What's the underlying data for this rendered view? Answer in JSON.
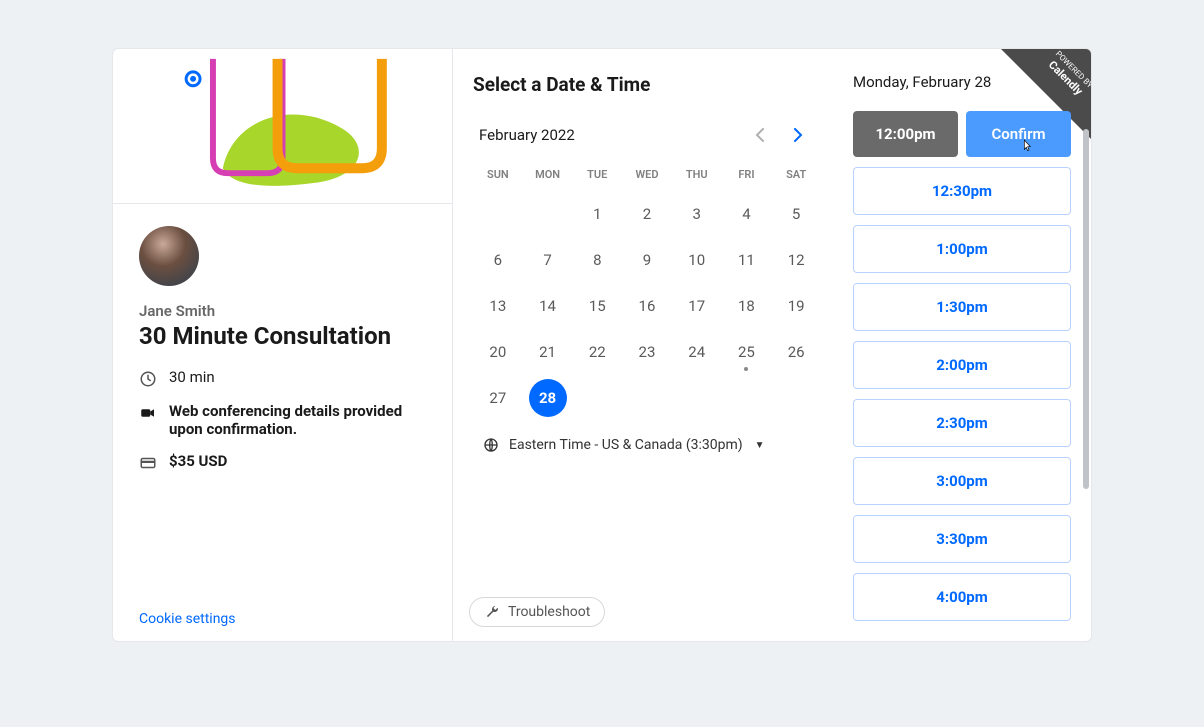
{
  "ribbon": {
    "powered_by": "POWERED BY",
    "brand": "Calendly"
  },
  "host": {
    "name": "Jane Smith"
  },
  "event": {
    "title": "30 Minute Consultation",
    "duration_label": "30 min",
    "location_label": "Web conferencing details provided upon confirmation.",
    "price_label": "$35 USD"
  },
  "footer": {
    "cookie_link": "Cookie settings",
    "troubleshoot": "Troubleshoot"
  },
  "picker": {
    "heading": "Select a Date & Time",
    "month_label": "February 2022",
    "dow": [
      "SUN",
      "MON",
      "TUE",
      "WED",
      "THU",
      "FRI",
      "SAT"
    ],
    "days": [
      {
        "n": "",
        "sel": false
      },
      {
        "n": "",
        "sel": false
      },
      {
        "n": "1",
        "sel": false
      },
      {
        "n": "2",
        "sel": false
      },
      {
        "n": "3",
        "sel": false
      },
      {
        "n": "4",
        "sel": false
      },
      {
        "n": "5",
        "sel": false
      },
      {
        "n": "6",
        "sel": false
      },
      {
        "n": "7",
        "sel": false
      },
      {
        "n": "8",
        "sel": false
      },
      {
        "n": "9",
        "sel": false
      },
      {
        "n": "10",
        "sel": false
      },
      {
        "n": "11",
        "sel": false
      },
      {
        "n": "12",
        "sel": false
      },
      {
        "n": "13",
        "sel": false
      },
      {
        "n": "14",
        "sel": false
      },
      {
        "n": "15",
        "sel": false
      },
      {
        "n": "16",
        "sel": false
      },
      {
        "n": "17",
        "sel": false
      },
      {
        "n": "18",
        "sel": false
      },
      {
        "n": "19",
        "sel": false
      },
      {
        "n": "20",
        "sel": false
      },
      {
        "n": "21",
        "sel": false
      },
      {
        "n": "22",
        "sel": false
      },
      {
        "n": "23",
        "sel": false
      },
      {
        "n": "24",
        "sel": false
      },
      {
        "n": "25",
        "sel": false,
        "dot": true
      },
      {
        "n": "26",
        "sel": false
      },
      {
        "n": "27",
        "sel": false
      },
      {
        "n": "28",
        "sel": true
      }
    ],
    "timezone_label": "Eastern Time - US & Canada (3:30pm)"
  },
  "times": {
    "selected_date_label": "Monday, February 28",
    "selected_time": "12:00pm",
    "confirm_label": "Confirm",
    "slots": [
      "12:30pm",
      "1:00pm",
      "1:30pm",
      "2:00pm",
      "2:30pm",
      "3:00pm",
      "3:30pm",
      "4:00pm"
    ]
  }
}
